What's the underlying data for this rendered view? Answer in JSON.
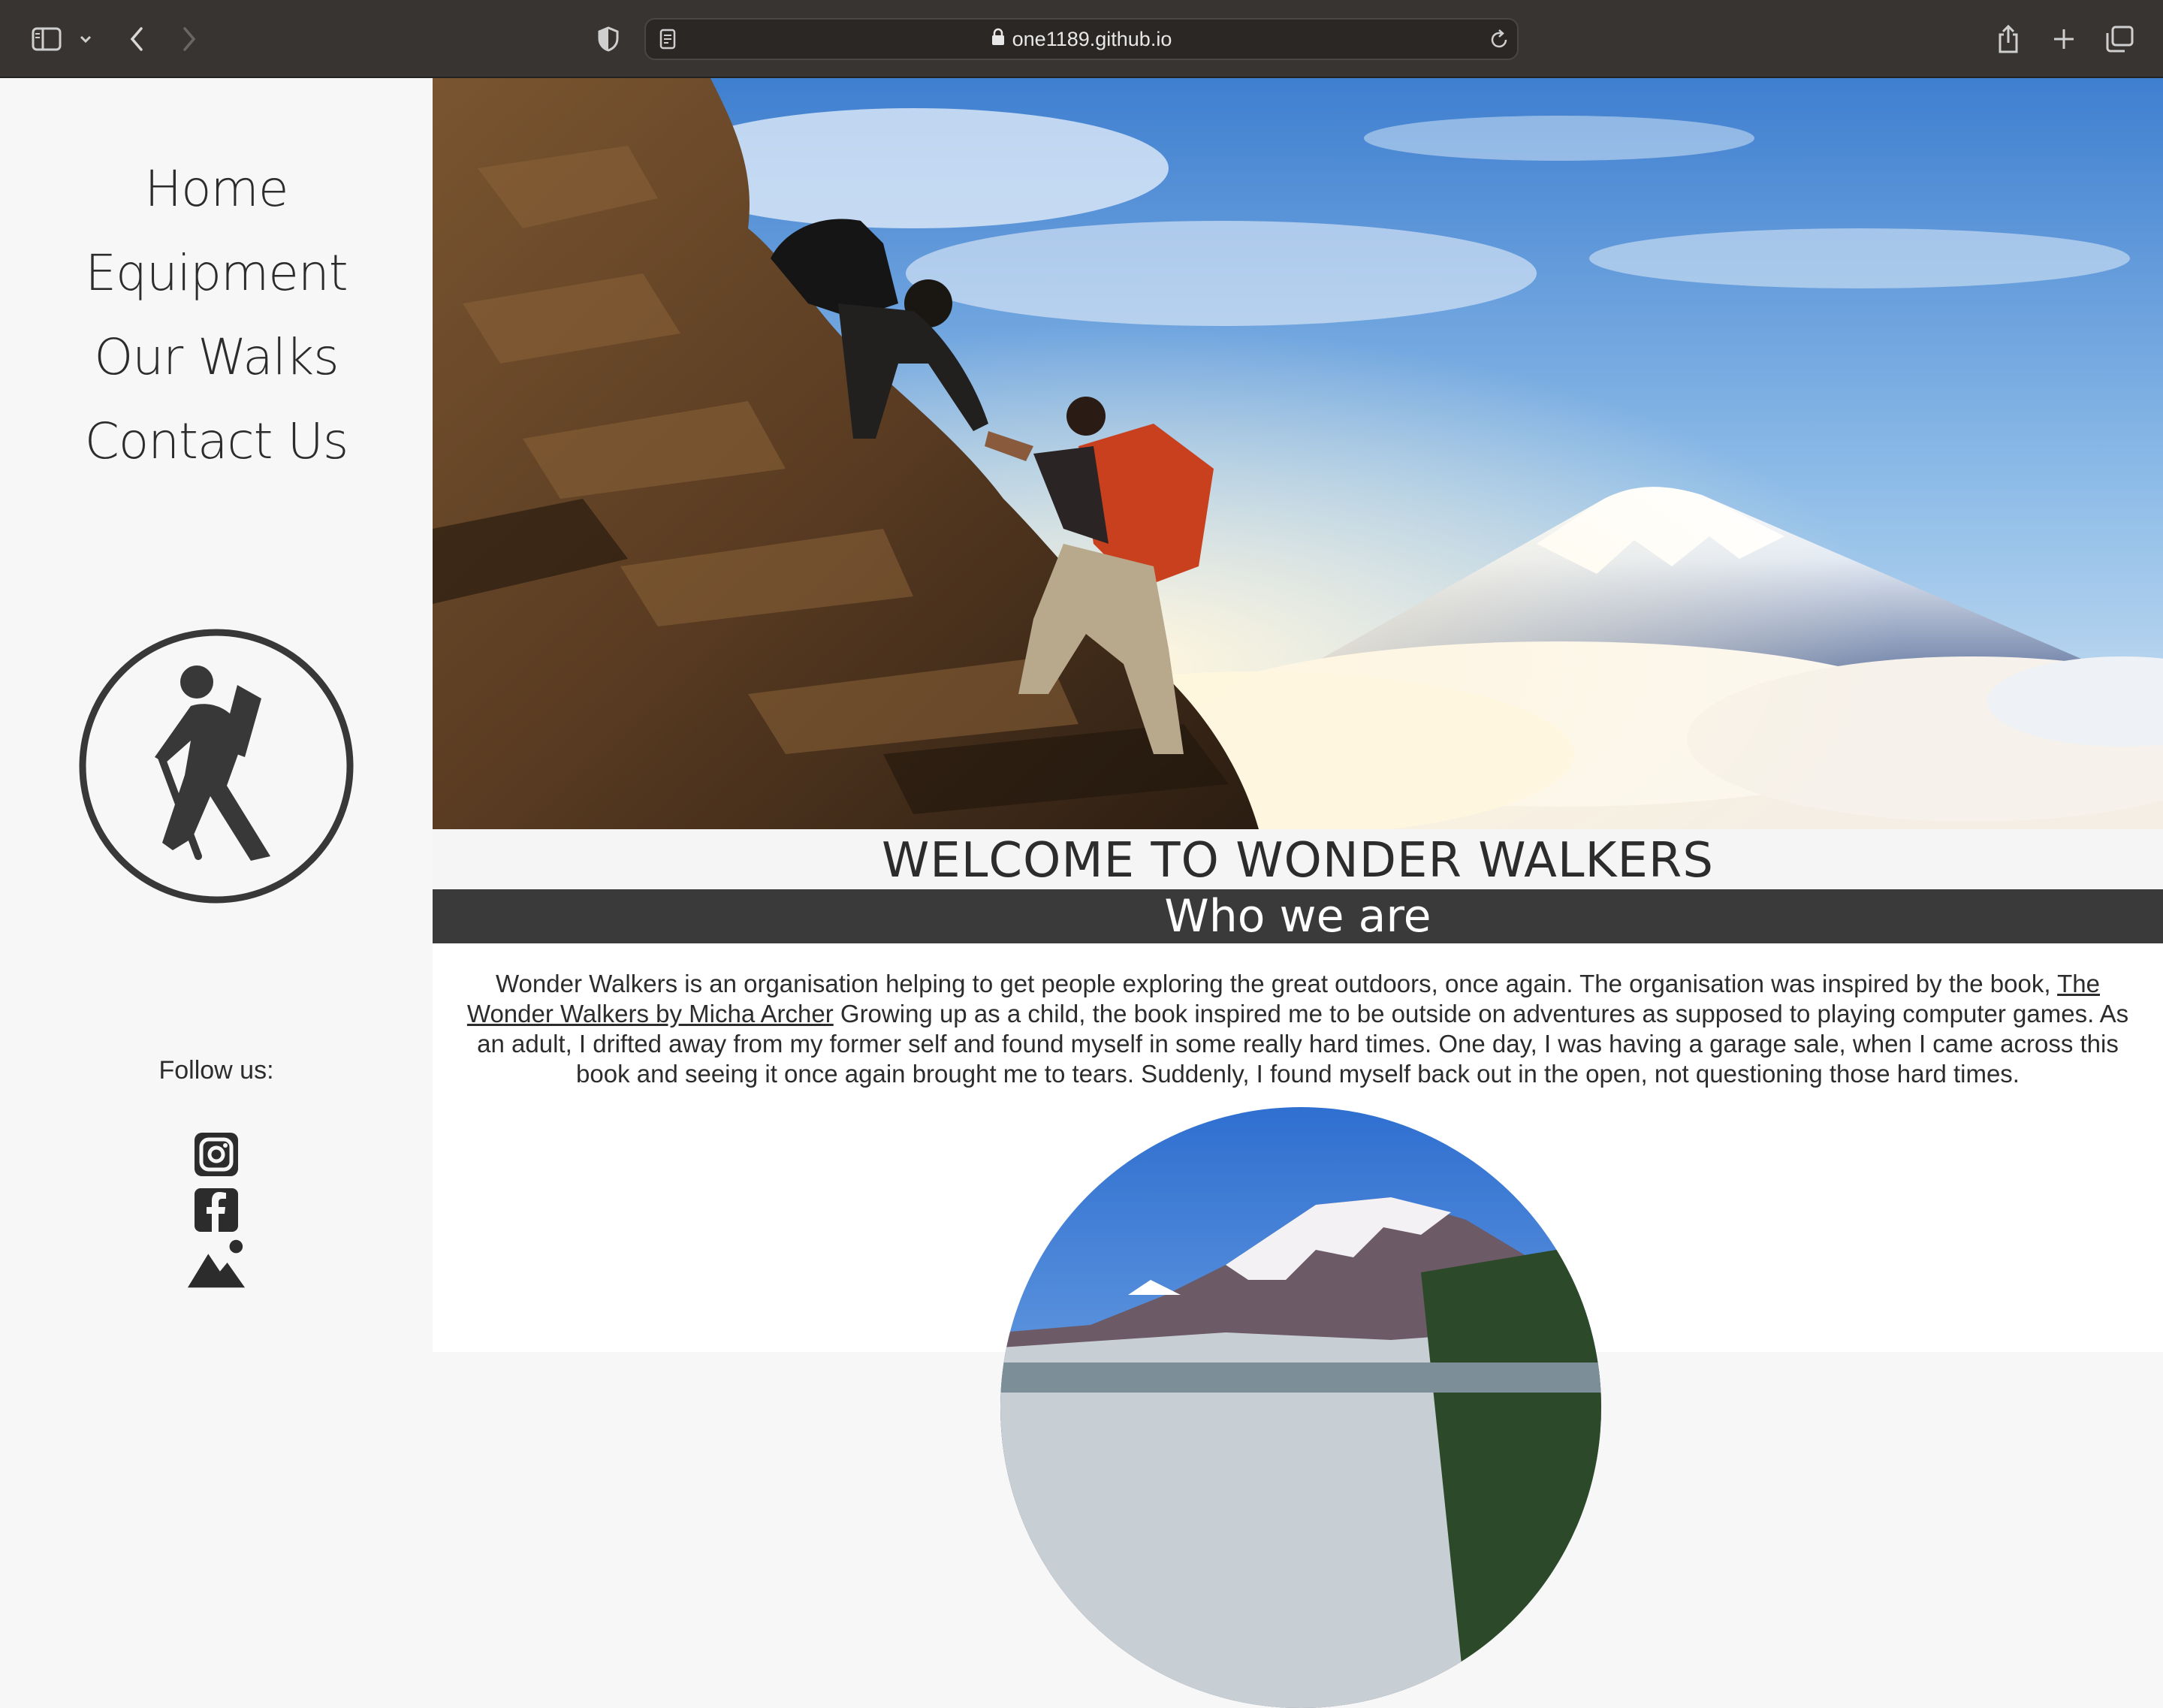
{
  "browser": {
    "url": "one1189.github.io",
    "icons": [
      "sidebar-icon",
      "chevron-down-icon",
      "back-icon",
      "forward-icon",
      "shield-icon",
      "page-icon",
      "lock-icon",
      "reload-icon",
      "share-icon",
      "plus-icon",
      "tabs-icon"
    ]
  },
  "sidebar": {
    "nav": [
      {
        "label": "Home"
      },
      {
        "label": "Equipment"
      },
      {
        "label": "Our Walks"
      },
      {
        "label": "Contact Us"
      }
    ],
    "logo_icon": "hiker-icon",
    "follow_label": "Follow us:",
    "social_icons": [
      "instagram-icon",
      "facebook-icon",
      "mountain-icon"
    ]
  },
  "main": {
    "hero_image": "hikers-climbing-mountain-photo",
    "welcome_title": "WELCOME TO WONDER WALKERS",
    "section_title": "Who we are",
    "about_text_before": "Wonder Walkers is an organisation helping to get people exploring the great outdoors, once again. The organisation was inspired by the book, ",
    "about_link": "The Wonder Walkers by Micha Archer",
    "about_text_after": " Growing up as a child, the book inspired me to be outside on adventures as supposed to playing computer games. As an adult, I drifted away from my former self and found myself in some really hard times. One day, I was having a garage sale, when I came across this book and seeing it once again brought me to tears. Suddenly, I found myself back out in the open, not questioning those hard times.",
    "circle_image": "snowy-mountain-photo"
  },
  "colors": {
    "chrome": "#383431",
    "sidebar_bg": "#f7f7f7",
    "text": "#2c2c2c",
    "band": "#3a3a3a",
    "band_text": "#ffffff"
  }
}
